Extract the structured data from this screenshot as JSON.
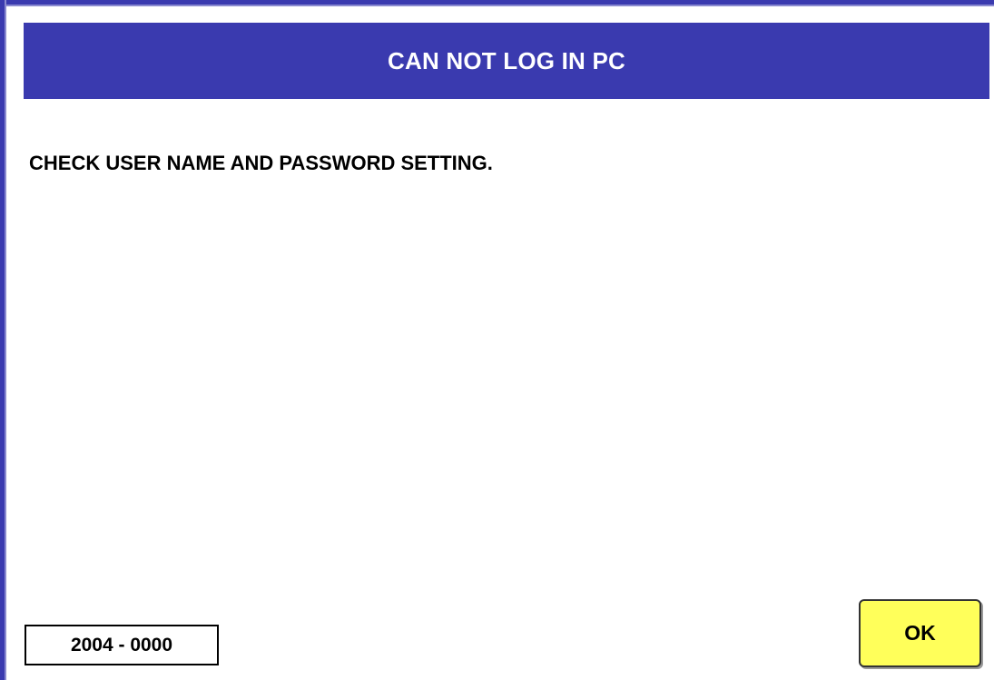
{
  "dialog": {
    "title": "CAN NOT LOG IN PC",
    "message": "CHECK USER NAME AND PASSWORD SETTING.",
    "error_code": "2004 - 0000",
    "ok_label": "OK"
  },
  "colors": {
    "title_bar": "#3a3aaf",
    "title_text": "#ffffff",
    "ok_button": "#ffff5a",
    "background": "#ffffff"
  }
}
